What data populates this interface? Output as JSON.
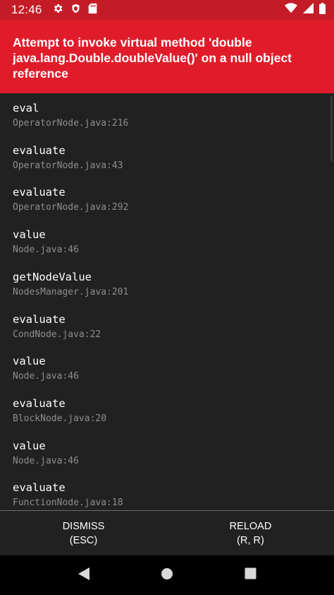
{
  "status_bar": {
    "time": "12:46",
    "icons": [
      "gear-icon",
      "shield-icon",
      "sd-card-icon",
      "wifi-icon",
      "signal-icon",
      "battery-icon"
    ]
  },
  "error": {
    "message": "Attempt to invoke virtual method 'double java.lang.Double.doubleValue()' on a null object reference"
  },
  "stack": [
    {
      "method": "eval",
      "file": "OperatorNode.java:216"
    },
    {
      "method": "evaluate",
      "file": "OperatorNode.java:43"
    },
    {
      "method": "evaluate",
      "file": "OperatorNode.java:292"
    },
    {
      "method": "value",
      "file": "Node.java:46"
    },
    {
      "method": "getNodeValue",
      "file": "NodesManager.java:201"
    },
    {
      "method": "evaluate",
      "file": "CondNode.java:22"
    },
    {
      "method": "value",
      "file": "Node.java:46"
    },
    {
      "method": "evaluate",
      "file": "BlockNode.java:20"
    },
    {
      "method": "value",
      "file": "Node.java:46"
    },
    {
      "method": "evaluate",
      "file": "FunctionNode.java:18"
    }
  ],
  "actions": {
    "dismiss": {
      "label": "DISMISS",
      "shortcut": "(ESC)"
    },
    "reload": {
      "label": "RELOAD",
      "shortcut": "(R, R)"
    }
  },
  "nav": {
    "icons": [
      "back-icon",
      "home-icon",
      "recents-icon"
    ]
  },
  "colors": {
    "header_red": "#e11c2a",
    "status_red": "#c41c27",
    "background": "#212121"
  }
}
